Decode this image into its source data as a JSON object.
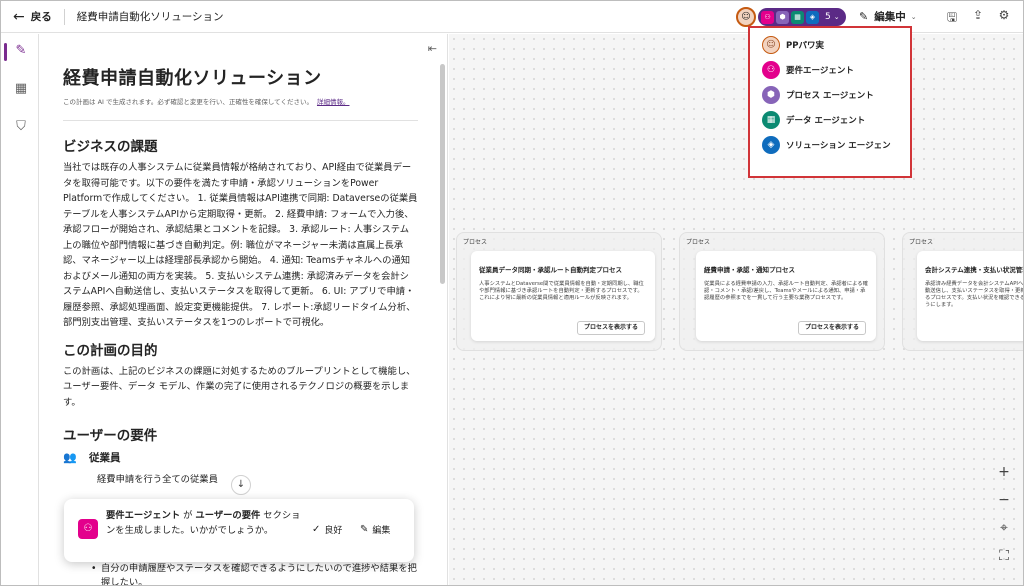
{
  "topbar": {
    "back_label": "戻る",
    "app_title": "経費申請自動化ソリューション",
    "agent_count": "5",
    "edit_mode_label": "編集中"
  },
  "document": {
    "title": "経費申請自動化ソリューション",
    "disclaimer": "この計画は AI で生成されます。必ず確認と変更を行い、正確性を確保してください。",
    "disclaimer_link": "詳細情報。",
    "section1_heading": "ビジネスの課題",
    "section1_body": "当社では既存の人事システムに従業員情報が格納されており、API経由で従業員データを取得可能です。以下の要件を満たす申請・承認ソリューションをPower Platformで作成してください。 1. 従業員情報はAPI連携で同期: Dataverseの従業員テーブルを人事システムAPIから定期取得・更新。 2. 経費申請: フォームで入力後、承認フローが開始され、承認結果とコメントを記録。 3. 承認ルート: 人事システム上の職位や部門情報に基づき自動判定。例: 職位がマネージャー未満は直属上長承認、マネージャー以上は経理部長承認から開始。 4. 通知: Teamsチャネルへの通知およびメール通知の両方を実装。 5. 支払いシステム連携: 承認済みデータを会計システムAPIへ自動送信し、支払いステータスを取得して更新。 6. UI: アプリで申請・履歴参照、承認処理画面、設定変更機能提供。 7. レポート:承認リードタイム分析、部門別支出管理、支払いステータスを1つのレポートで可視化。",
    "section2_heading": "この計画の目的",
    "section2_body": "この計画は、上記のビジネスの課題に対処するためのブループリントとして機能し、ユーザー要件、データ モデル、作業の完了に使用されるテクノロジの概要を示します。",
    "section3_heading": "ユーザーの要件",
    "user_group_label": "従業員",
    "user_group_desc": "経費申請を行う全ての従業員",
    "bullet_text": "自分の申請履歴やステータスを確認できるようにしたいので進捗や結果を把握したい。"
  },
  "toast": {
    "agent_name": "要件エージェント",
    "msg_part1": " が ",
    "section_name": "ユーザーの要件",
    "msg_part2": " セクションを生成しました。いかがでしょうか。",
    "good_label": "良好",
    "edit_label": "編集"
  },
  "canvas": {
    "lanes": [
      {
        "tag": "プロセス",
        "card_title": "従業員データ同期・承認ルート自動判定プロセス",
        "card_desc": "人事システムとDataverse間で従業員情報を自動・定期同期し、職位や部門情報に基づき承認ルートを自動判定・更新するプロセスです。これにより常に最新の従業員情報と適用ルールが反映されます。",
        "card_button": "プロセスを表示する"
      },
      {
        "tag": "プロセス",
        "card_title": "経費申請・承認・通知プロセス",
        "card_desc": "従業員による経費申請の入力、承認ルート自動判定、承認者による確認・コメント・承認/差戻し、Teamsやメールによる通知、申請・承認履歴の参照までを一貫して行う主要な業務プロセスです。",
        "card_button": "プロセスを表示する"
      },
      {
        "tag": "プロセス",
        "card_title": "会計システム連携・支払い状況管理",
        "card_desc": "承認済み経費データを会計システムAPIへ自動送信し、支払いステータスを取得・更新するプロセスです。支払い状況を確認できるようにします。",
        "card_button": ""
      }
    ]
  },
  "agents_dropdown": {
    "items": [
      {
        "label": "PPパワ実",
        "icon": "user-avatar-icon",
        "color": "#f2d3c0"
      },
      {
        "label": "要件エージェント",
        "icon": "requirements-agent-icon",
        "color": "#e3008c"
      },
      {
        "label": "プロセス エージェント",
        "icon": "process-agent-icon",
        "color": "#8764b8"
      },
      {
        "label": "データ エージェント",
        "icon": "data-agent-icon",
        "color": "#0b8a72"
      },
      {
        "label": "ソリューション エージェン",
        "icon": "solution-agent-icon",
        "color": "#0f6cbd"
      }
    ]
  },
  "colors": {
    "accent": "#7a2c8f",
    "highlight_border": "#d13438"
  }
}
